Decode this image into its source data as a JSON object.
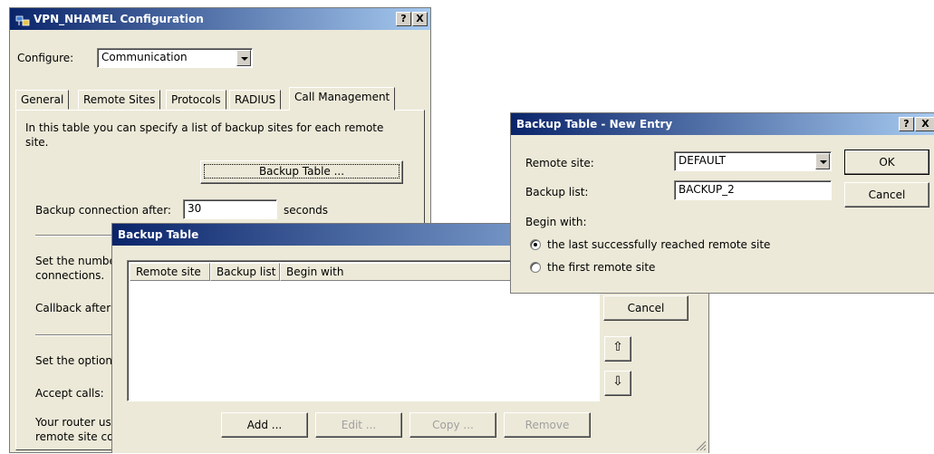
{
  "main_window": {
    "title": "VPN_NHAMEL Configuration",
    "help_button": "?",
    "close_button": "X",
    "configure_label": "Configure:",
    "configure_value": "Communication",
    "tabs": [
      {
        "label": "General"
      },
      {
        "label": "Remote Sites"
      },
      {
        "label": "Protocols"
      },
      {
        "label": "RADIUS"
      },
      {
        "label": "Call Management"
      }
    ],
    "description": "In this table you can specify a list of backup sites for each remote site.",
    "backup_table_button": "Backup Table ...",
    "backup_connection_label": "Backup connection after:",
    "backup_connection_value": "30",
    "backup_connection_unit": "seconds",
    "set_number_text_1": "Set the numbe",
    "set_number_text_2": "connections.",
    "callback_after_text": "Callback after",
    "set_option_text": "Set the option",
    "accept_calls_text": "Accept calls:",
    "router_text_1": "Your router us",
    "router_text_2": "remote site co"
  },
  "backup_table_dialog": {
    "title": "Backup Table",
    "columns": [
      "Remote site",
      "Backup list",
      "Begin with"
    ],
    "rows": [],
    "cancel_button": "Cancel",
    "move_up_symbol": "⇧",
    "move_down_symbol": "⇩",
    "add_button": "Add ...",
    "edit_button": "Edit ...",
    "copy_button": "Copy ...",
    "remove_button": "Remove"
  },
  "new_entry_dialog": {
    "title": "Backup Table - New Entry",
    "help_button": "?",
    "close_button": "X",
    "remote_site_label": "Remote site:",
    "remote_site_value": "DEFAULT",
    "backup_list_label": "Backup list:",
    "backup_list_value": "BACKUP_2",
    "begin_with_label": "Begin with:",
    "option_last": "the last successfully reached remote site",
    "option_first": "the first remote site",
    "selected_option": "last",
    "ok_button": "OK",
    "cancel_button": "Cancel"
  },
  "colors": {
    "titlebar_start": "#0a246a",
    "titlebar_end": "#a6caf0",
    "dialog_face": "#ece9d8"
  },
  "icons": [
    "network-config-icon",
    "help-icon",
    "close-icon",
    "dropdown-arrow-icon",
    "arrow-up-icon",
    "arrow-down-icon",
    "resize-grip-icon"
  ]
}
